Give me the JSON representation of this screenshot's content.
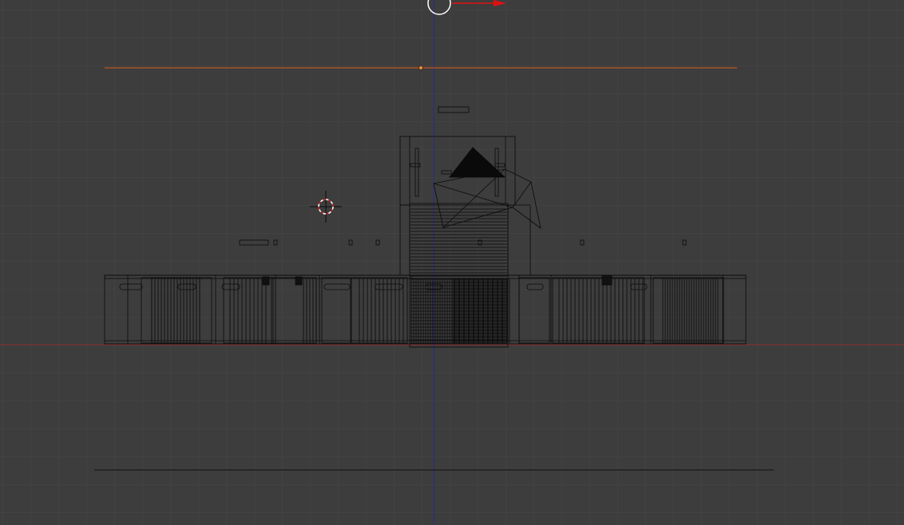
{
  "viewport": {
    "view": "front-orthographic",
    "display_mode": "wireframe",
    "grid": true
  },
  "colors": {
    "background": "#3d3d3d",
    "grid_line": "#464646",
    "wire": "#0a0a0a",
    "x_axis": "#8a2a2a",
    "z_axis": "#2a2a8a",
    "selection": "#e05a20",
    "gizmo_x": "#e01010",
    "cursor_red": "#d02020",
    "cursor_white": "#ffffff"
  },
  "scene": {
    "objects": [
      "lamp-plane",
      "building-main-wing",
      "building-center-tower",
      "roof-pyramid",
      "camera-frustum",
      "ground-plane"
    ],
    "active_object": "lamp-plane"
  },
  "manipulator": {
    "type": "translate",
    "visible_axes": [
      "x"
    ]
  },
  "cursor_3d": {
    "icon": "crosshair-cursor-icon"
  }
}
